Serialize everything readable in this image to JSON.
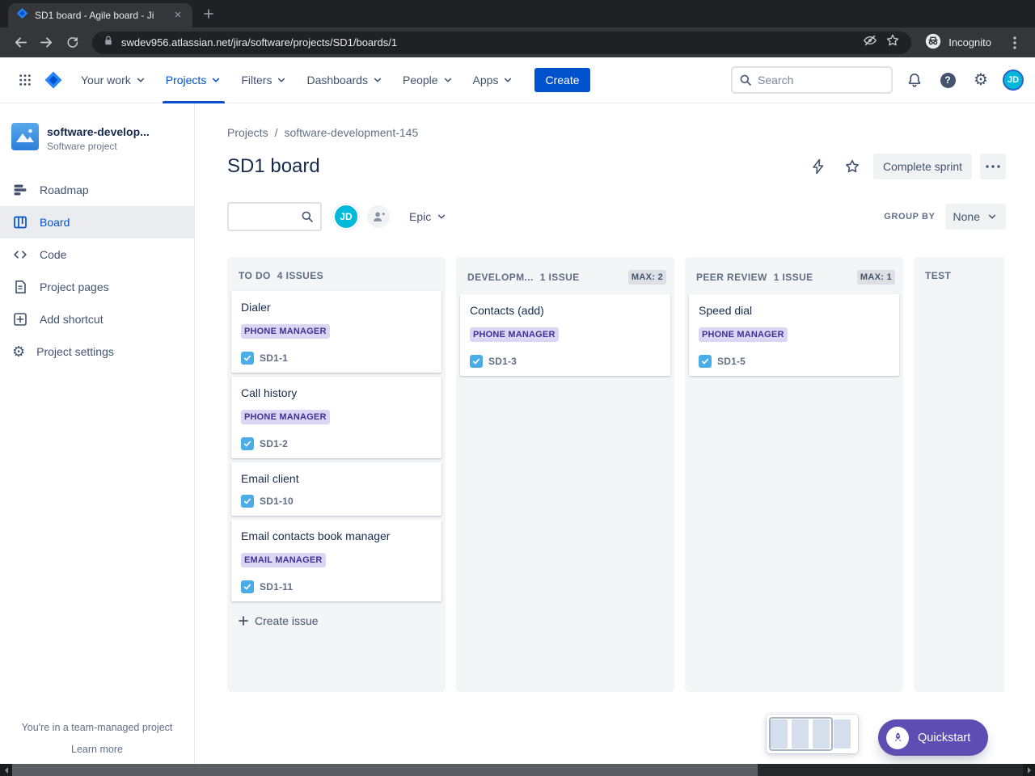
{
  "browser": {
    "tab_title": "SD1 board - Agile board - Ji",
    "url": "swdev956.atlassian.net/jira/software/projects/SD1/boards/1",
    "incognito_label": "Incognito"
  },
  "header": {
    "nav": [
      {
        "label": "Your work"
      },
      {
        "label": "Projects"
      },
      {
        "label": "Filters"
      },
      {
        "label": "Dashboards"
      },
      {
        "label": "People"
      },
      {
        "label": "Apps"
      }
    ],
    "create_label": "Create",
    "search_placeholder": "Search",
    "avatar_initials": "JD"
  },
  "sidebar": {
    "project_name": "software-develop...",
    "project_type": "Software project",
    "items": [
      {
        "label": "Roadmap"
      },
      {
        "label": "Board"
      },
      {
        "label": "Code"
      },
      {
        "label": "Project pages"
      },
      {
        "label": "Add shortcut"
      },
      {
        "label": "Project settings"
      }
    ],
    "footer_text": "You're in a team-managed project",
    "footer_link": "Learn more"
  },
  "main": {
    "breadcrumb": {
      "root": "Projects",
      "project": "software-development-145"
    },
    "title": "SD1 board",
    "complete_sprint_label": "Complete sprint",
    "toolbar": {
      "avatar_initials": "JD",
      "epic_filter_label": "Epic",
      "group_by_label": "GROUP BY",
      "group_by_value": "None"
    },
    "columns": [
      {
        "name": "TO DO",
        "count": "4 ISSUES",
        "max": "",
        "create_issue_label": "Create issue",
        "cards": [
          {
            "title": "Dialer",
            "badge": "PHONE MANAGER",
            "key": "SD1-1"
          },
          {
            "title": "Call history",
            "badge": "PHONE MANAGER",
            "key": "SD1-2"
          },
          {
            "title": "Email client",
            "key": "SD1-10"
          },
          {
            "title": "Email contacts book manager",
            "badge": "EMAIL MANAGER",
            "key": "SD1-11"
          }
        ]
      },
      {
        "name": "DEVELOPM...",
        "count": "1 ISSUE",
        "max": "MAX: 2",
        "cards": [
          {
            "title": "Contacts (add)",
            "badge": "PHONE MANAGER",
            "key": "SD1-3"
          }
        ]
      },
      {
        "name": "PEER REVIEW",
        "count": "1 ISSUE",
        "max": "MAX: 1",
        "cards": [
          {
            "title": "Speed dial",
            "badge": "PHONE MANAGER",
            "key": "SD1-5"
          }
        ]
      },
      {
        "name": "TEST",
        "count": "",
        "max": "",
        "cards": []
      }
    ]
  },
  "quickstart": {
    "label": "Quickstart"
  },
  "colors": {
    "jira_blue": "#0052CC",
    "epic_badge_bg": "#DCD6F5",
    "epic_badge_text": "#403294",
    "task_icon_blue": "#4BADE8",
    "avatar_teal": "#00B8D9",
    "quickstart_purple": "#5E4DB2",
    "column_bg": "#F4F5F7",
    "sidebar_selected_bg": "#EBECF0"
  }
}
